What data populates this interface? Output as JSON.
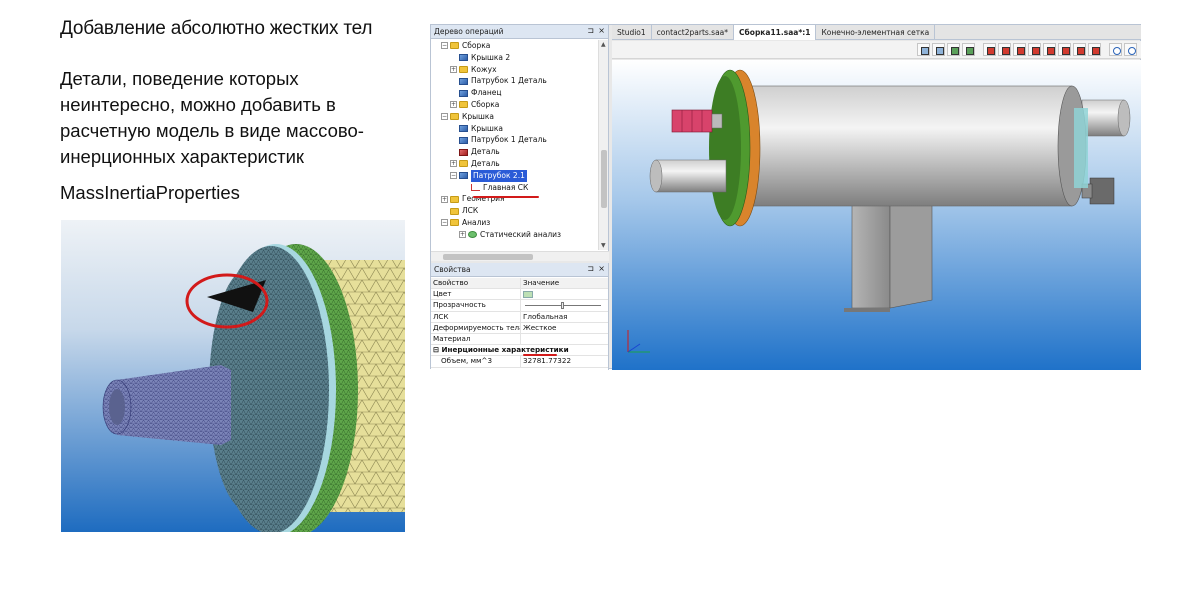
{
  "slide": {
    "title": "Добавление абсолютно жестких тел",
    "body": "Детали, поведение которых неинтересно, можно добавить в расчетную модель в виде массово-инерционных характеристик",
    "term": "MassInertiaProperties"
  },
  "tree_panel": {
    "title": "Дерево операций",
    "pin_icon": "pin-icon",
    "close_icon": "close-icon",
    "nodes": [
      {
        "label": "Сборка",
        "icon": "folder-icon"
      },
      {
        "label": "Крышка 2",
        "icon": "part-icon"
      },
      {
        "label": "Кожух",
        "icon": "folder-icon"
      },
      {
        "label": "Патрубок 1 Деталь",
        "icon": "part-icon"
      },
      {
        "label": "Фланец",
        "icon": "part-icon"
      },
      {
        "label": "Сборка",
        "icon": "folder-icon"
      },
      {
        "label": "Крышка",
        "icon": "folder-icon"
      },
      {
        "label": "Крышка",
        "icon": "part-icon"
      },
      {
        "label": "Патрубок 1 Деталь",
        "icon": "part-icon"
      },
      {
        "label": "Деталь",
        "icon": "part-red-icon"
      },
      {
        "label": "Деталь",
        "icon": "folder-icon"
      },
      {
        "label": "Патрубок 2.1",
        "icon": "part-icon"
      },
      {
        "label": "Главная СК",
        "icon": "coordinate-system-icon"
      },
      {
        "label": "Геометрия",
        "icon": "folder-icon"
      },
      {
        "label": "ЛСК",
        "icon": "folder-icon"
      },
      {
        "label": "Анализ",
        "icon": "folder-icon"
      },
      {
        "label": "Статический анализ",
        "icon": "analysis-icon"
      }
    ]
  },
  "props_panel": {
    "title": "Свойства",
    "col_name": "Свойство",
    "col_value": "Значение",
    "rows": [
      {
        "name": "Цвет",
        "value": ""
      },
      {
        "name": "Прозрачность",
        "value": ""
      },
      {
        "name": "ЛСК",
        "value": "Глобальная"
      },
      {
        "name": "Деформируемость тела",
        "value": "Жесткое"
      },
      {
        "name": "Материал",
        "value": ""
      }
    ],
    "group": "Инерционные характеристики",
    "group_rows": [
      {
        "name": "Объем, мм^3",
        "value": "32781.77322"
      }
    ],
    "transparency": 0.5,
    "color": "#bde0b5"
  },
  "tabs": [
    {
      "label": "Studio1",
      "active": false
    },
    {
      "label": "contact2parts.saa*",
      "active": false
    },
    {
      "label": "Сборка11.saa*:1",
      "active": true
    },
    {
      "label": "Конечно-элементная сетка",
      "active": false
    }
  ],
  "toolbar_icons": [
    "view-icon",
    "view-icon",
    "view-icon",
    "view-icon",
    "cube-icon",
    "cube-icon",
    "cube-icon",
    "cube-icon",
    "cube-icon",
    "cube-icon",
    "cube-icon",
    "cube-icon",
    "zoom-in-icon",
    "zoom-icon"
  ],
  "colors": {
    "viewport_bg_top": "#ffffff",
    "viewport_bg_bottom": "#1f72c9",
    "highlight": "#d21a1a",
    "selection": "#2a5bd7",
    "flange_green": "#4f9a2f",
    "flange_orange": "#d9842c"
  }
}
